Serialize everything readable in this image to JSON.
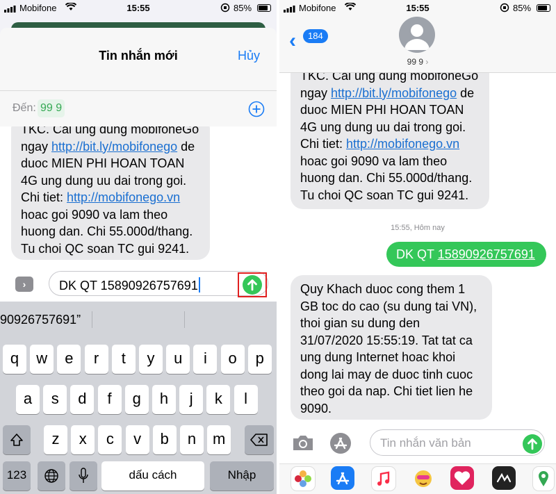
{
  "status_bar": {
    "carrier": "Mobifone",
    "time": "15:55",
    "battery": "85%"
  },
  "left": {
    "sheet": {
      "title": "Tin nhắn mới",
      "cancel": "Hủy"
    },
    "recipient": {
      "label": "Đến:",
      "value": "99 9"
    },
    "message_lines": [
      "TKC. Cai ung dung mobifoneGo",
      "ngay http://bit.ly/mobifonego de",
      "duoc MIEN PHI HOAN TOAN",
      "4G ung dung uu dai trong goi.",
      "Chi tiet: http://mobifonego.vn",
      "hoac goi 9090 va lam theo",
      "huong dan. Chi 55.000d/thang.",
      "Tu choi QC soan TC gui 9241."
    ],
    "input_value": "DK QT 15890926757691",
    "suggestion": "90926757691”",
    "keyboard": {
      "row1": [
        "q",
        "w",
        "e",
        "r",
        "t",
        "y",
        "u",
        "i",
        "o",
        "p"
      ],
      "row2": [
        "a",
        "s",
        "d",
        "f",
        "g",
        "h",
        "j",
        "k",
        "l"
      ],
      "row3": [
        "z",
        "x",
        "c",
        "v",
        "b",
        "n",
        "m"
      ],
      "numbers": "123",
      "space": "dấu cách",
      "return": "Nhập"
    }
  },
  "right": {
    "back_count": "184",
    "contact": "99 9",
    "message_lines": [
      "TKC. Cai ung dung mobifoneGo",
      "ngay http://bit.ly/mobifonego de",
      "duoc MIEN PHI HOAN TOAN",
      "4G ung dung uu dai trong goi.",
      "Chi tiet: http://mobifonego.vn",
      "hoac goi 9090 va lam theo",
      "huong dan. Chi 55.000d/thang.",
      "Tu choi QC soan TC gui 9241."
    ],
    "timestamp": "15:55, Hôm nay",
    "sent": {
      "prefix": "DK QT",
      "number": "15890926757691"
    },
    "reply_lines": [
      "Quy Khach duoc cong them 1",
      "GB toc do cao (su dung tai VN),",
      "thoi gian su dung den",
      "31/07/2020 15:55:19. Tat tat ca",
      "ung dung Internet hoac khoi",
      "dong lai may de duoc tinh cuoc",
      "theo goi da nap. Chi tiet lien he",
      "9090."
    ],
    "placeholder": "Tin nhắn văn bản",
    "tray_apps": [
      "photos-app",
      "app-store-app",
      "music-app",
      "memoji-app",
      "heart-app",
      "here-app",
      "maps-app"
    ]
  },
  "colors": {
    "accent": "#1a7cf5",
    "green": "#34c759",
    "highlight": "#e02020"
  }
}
